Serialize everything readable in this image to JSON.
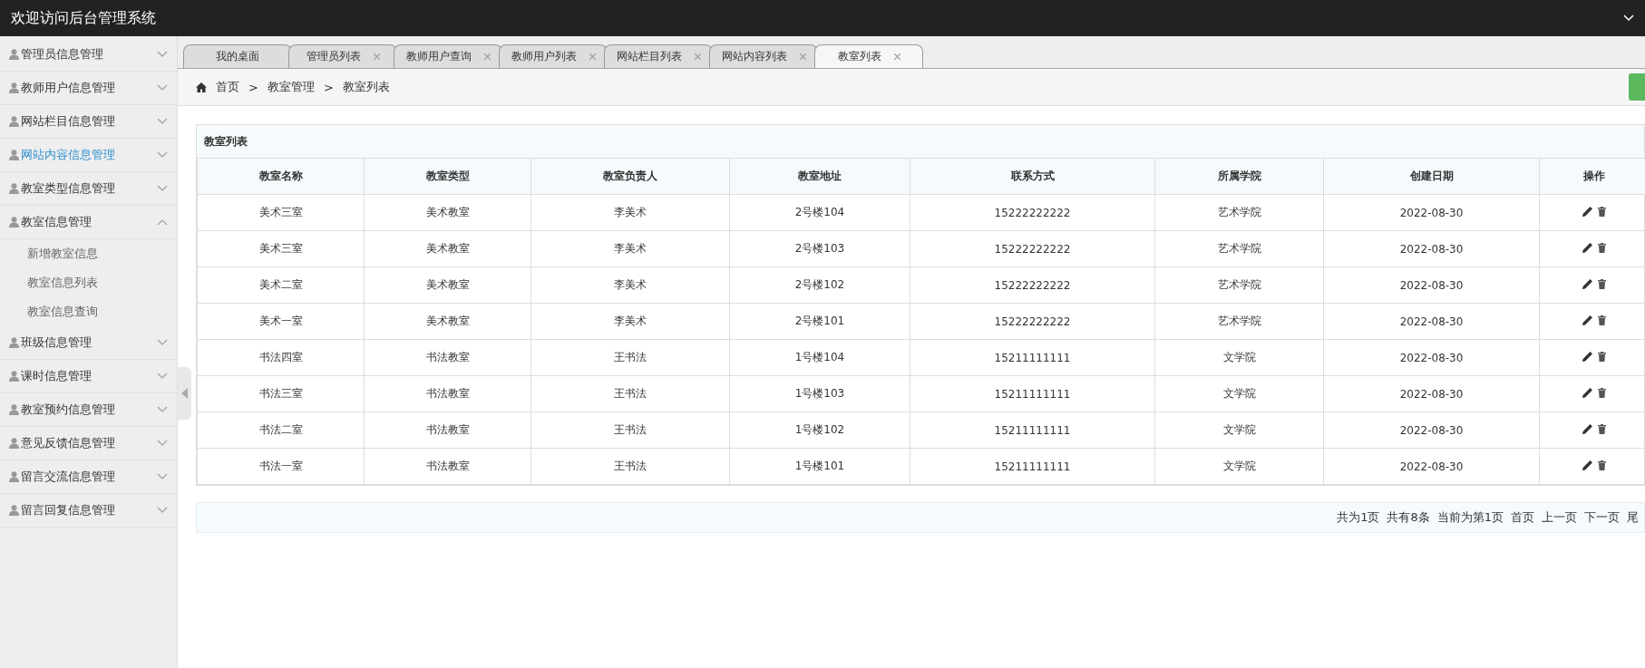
{
  "header": {
    "title": "欢迎访问后台管理系统"
  },
  "sidebar": {
    "items": [
      {
        "label": "管理员信息管理",
        "selected": false,
        "expanded": false
      },
      {
        "label": "教师用户信息管理",
        "selected": false,
        "expanded": false
      },
      {
        "label": "网站栏目信息管理",
        "selected": false,
        "expanded": false
      },
      {
        "label": "网站内容信息管理",
        "selected": true,
        "expanded": false
      },
      {
        "label": "教室类型信息管理",
        "selected": false,
        "expanded": false
      },
      {
        "label": "教室信息管理",
        "selected": false,
        "expanded": true,
        "children": [
          {
            "label": "新增教室信息"
          },
          {
            "label": "教室信息列表"
          },
          {
            "label": "教室信息查询"
          }
        ]
      },
      {
        "label": "班级信息管理",
        "selected": false,
        "expanded": false
      },
      {
        "label": "课时信息管理",
        "selected": false,
        "expanded": false
      },
      {
        "label": "教室预约信息管理",
        "selected": false,
        "expanded": false
      },
      {
        "label": "意见反馈信息管理",
        "selected": false,
        "expanded": false
      },
      {
        "label": "留言交流信息管理",
        "selected": false,
        "expanded": false
      },
      {
        "label": "留言回复信息管理",
        "selected": false,
        "expanded": false
      }
    ]
  },
  "tabs": [
    {
      "label": "我的桌面",
      "selected": false,
      "closable": false
    },
    {
      "label": "管理员列表",
      "selected": false,
      "closable": true
    },
    {
      "label": "教师用户查询",
      "selected": false,
      "closable": true
    },
    {
      "label": "教师用户列表",
      "selected": false,
      "closable": true
    },
    {
      "label": "网站栏目列表",
      "selected": false,
      "closable": true
    },
    {
      "label": "网站内容列表",
      "selected": false,
      "closable": true
    },
    {
      "label": "教室列表",
      "selected": true,
      "closable": true
    }
  ],
  "breadcrumb": {
    "separator": ">",
    "items": [
      "首页",
      "教室管理",
      "教室列表"
    ]
  },
  "table": {
    "title": "教室列表",
    "columns": [
      "教室名称",
      "教室类型",
      "教室负责人",
      "教室地址",
      "联系方式",
      "所属学院",
      "创建日期",
      "操作"
    ],
    "rows": [
      [
        "美术三室",
        "美术教室",
        "李美术",
        "2号楼104",
        "15222222222",
        "艺术学院",
        "2022-08-30"
      ],
      [
        "美术三室",
        "美术教室",
        "李美术",
        "2号楼103",
        "15222222222",
        "艺术学院",
        "2022-08-30"
      ],
      [
        "美术二室",
        "美术教室",
        "李美术",
        "2号楼102",
        "15222222222",
        "艺术学院",
        "2022-08-30"
      ],
      [
        "美术一室",
        "美术教室",
        "李美术",
        "2号楼101",
        "15222222222",
        "艺术学院",
        "2022-08-30"
      ],
      [
        "书法四室",
        "书法教室",
        "王书法",
        "1号楼104",
        "15211111111",
        "文学院",
        "2022-08-30"
      ],
      [
        "书法三室",
        "书法教室",
        "王书法",
        "1号楼103",
        "15211111111",
        "文学院",
        "2022-08-30"
      ],
      [
        "书法二室",
        "书法教室",
        "王书法",
        "1号楼102",
        "15211111111",
        "文学院",
        "2022-08-30"
      ],
      [
        "书法一室",
        "书法教室",
        "王书法",
        "1号楼101",
        "15211111111",
        "文学院",
        "2022-08-30"
      ]
    ]
  },
  "pagination": {
    "info": [
      "共为1页",
      "共有8条",
      "当前为第1页"
    ],
    "links": [
      "首页",
      "上一页",
      "下一页",
      "尾"
    ]
  }
}
